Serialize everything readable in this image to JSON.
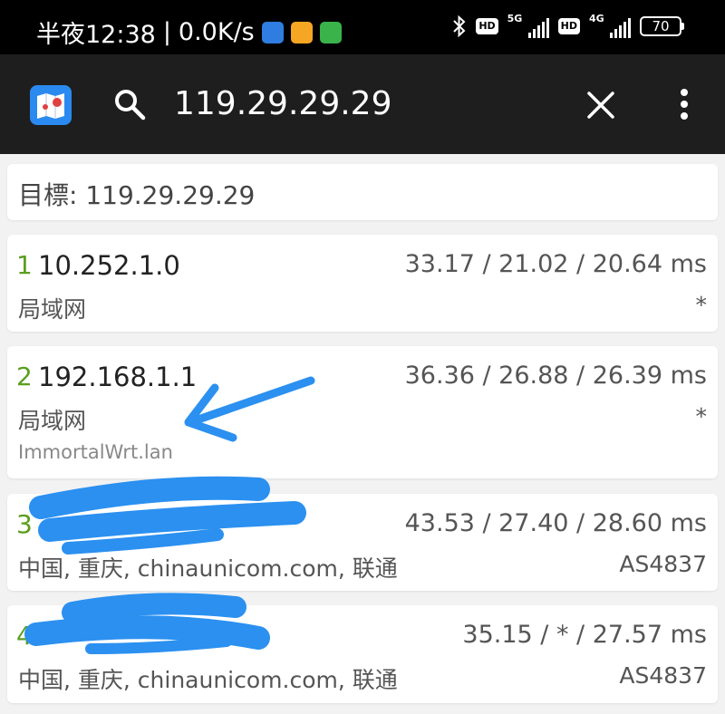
{
  "status_bar": {
    "time_text": "半夜12:38",
    "speed": "0.0K/s",
    "bluetooth_icon": "bluetooth-icon",
    "hd1": "HD",
    "net1": "5G",
    "hd2": "HD",
    "net2": "4G",
    "battery": "70"
  },
  "toolbar": {
    "query": "119.29.29.29",
    "app_icon": "map-app-icon",
    "search_icon": "search-icon",
    "close_icon": "close-icon",
    "more_icon": "more-vert-icon"
  },
  "target": {
    "text": "目標: 119.29.29.29"
  },
  "hops": [
    {
      "num": "1",
      "ip": "10.252.1.0",
      "times": "33.17 / 21.02 / 20.64 ms",
      "loc": "局域网",
      "as": "*"
    },
    {
      "num": "2",
      "ip": "192.168.1.1",
      "times": "36.36 / 26.88 / 26.39 ms",
      "loc": "局域网",
      "as": "*",
      "host": "ImmortalWrt.lan"
    },
    {
      "num": "3",
      "ip": "",
      "times": "43.53 / 27.40 / 28.60 ms",
      "loc": "中国, 重庆, chinaunicom.com, 联通",
      "as": "AS4837"
    },
    {
      "num": "4",
      "ip": "",
      "times": "35.15 / * / 27.57 ms",
      "loc": "中国, 重庆, chinaunicom.com, 联通",
      "as": "AS4837"
    }
  ],
  "colors": {
    "hop_number": "#5a9e1e",
    "toolbar_bg": "#1e1e1e",
    "annotation_blue": "#2b90f0"
  }
}
